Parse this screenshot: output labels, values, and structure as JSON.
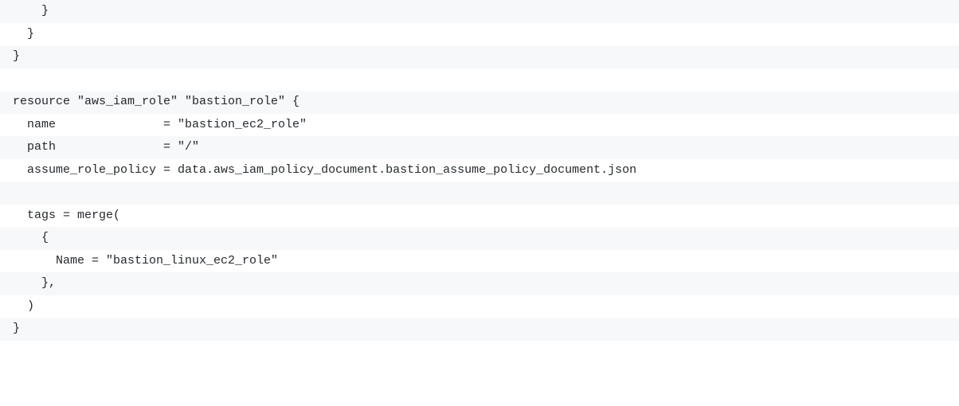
{
  "code": {
    "lines": [
      "    }",
      "  }",
      "}",
      "",
      "resource \"aws_iam_role\" \"bastion_role\" {",
      "  name               = \"bastion_ec2_role\"",
      "  path               = \"/\"",
      "  assume_role_policy = data.aws_iam_policy_document.bastion_assume_policy_document.json",
      "",
      "  tags = merge(",
      "    {",
      "      Name = \"bastion_linux_ec2_role\"",
      "    },",
      "  )",
      "}"
    ]
  }
}
